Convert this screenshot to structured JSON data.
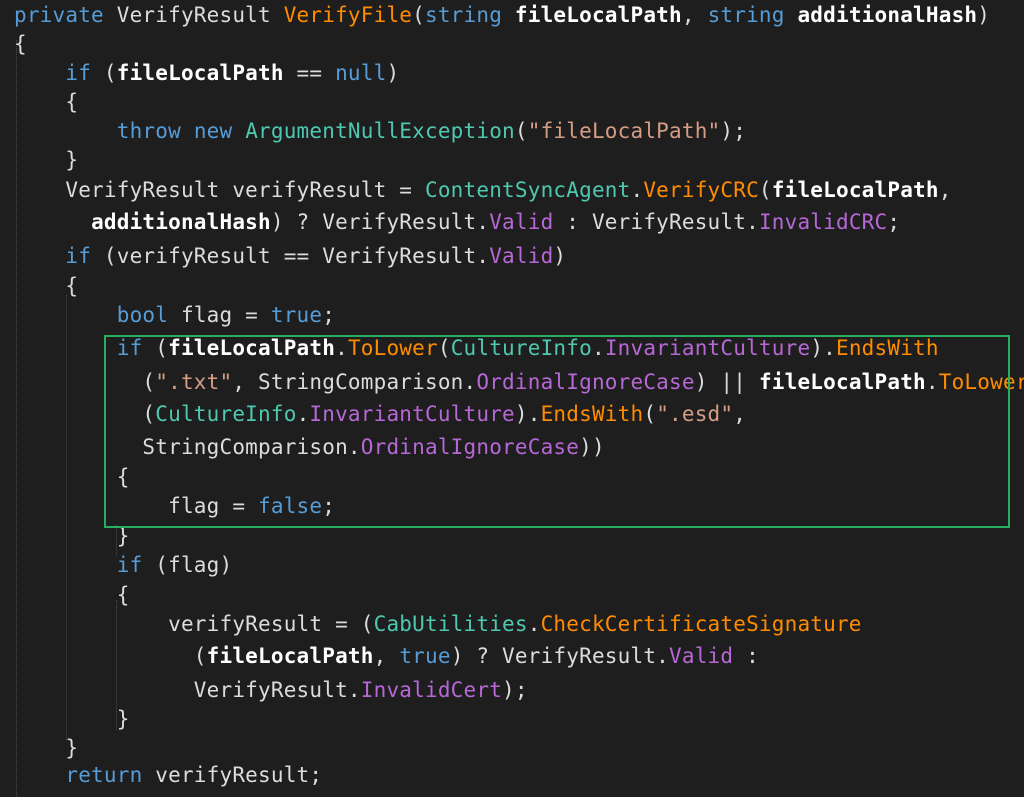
{
  "colors": {
    "background": "#1e1e1e",
    "keyword": "#569cd6",
    "class": "#4ec9b0",
    "method": "#ff8c00",
    "property": "#b767d6",
    "string": "#d69d85",
    "parameter": "#ffffff",
    "plain": "#dcdcdc",
    "highlight_border": "#27ae60"
  },
  "code": {
    "lines": [
      [
        [
          "kw",
          "private"
        ],
        [
          "plain",
          " "
        ],
        [
          "plain",
          "VerifyResult"
        ],
        [
          "plain",
          " "
        ],
        [
          "meth",
          "VerifyFile"
        ],
        [
          "punc",
          "("
        ],
        [
          "kw",
          "string"
        ],
        [
          "plain",
          " "
        ],
        [
          "param",
          "fileLocalPath"
        ],
        [
          "punc",
          ", "
        ],
        [
          "kw",
          "string"
        ],
        [
          "plain",
          " "
        ],
        [
          "param",
          "additionalHash"
        ],
        [
          "punc",
          ")"
        ]
      ],
      [
        [
          "punc",
          "{"
        ]
      ],
      [
        [
          "plain",
          "    "
        ],
        [
          "kw",
          "if"
        ],
        [
          "plain",
          " ("
        ],
        [
          "param",
          "fileLocalPath"
        ],
        [
          "plain",
          " == "
        ],
        [
          "kw",
          "null"
        ],
        [
          "punc",
          ")"
        ]
      ],
      [
        [
          "plain",
          "    "
        ],
        [
          "punc",
          "{"
        ]
      ],
      [
        [
          "plain",
          "        "
        ],
        [
          "kw",
          "throw"
        ],
        [
          "plain",
          " "
        ],
        [
          "kw",
          "new"
        ],
        [
          "plain",
          " "
        ],
        [
          "cls",
          "ArgumentNullException"
        ],
        [
          "punc",
          "("
        ],
        [
          "str",
          "\"fileLocalPath\""
        ],
        [
          "punc",
          ");"
        ]
      ],
      [
        [
          "plain",
          "    "
        ],
        [
          "punc",
          "}"
        ]
      ],
      [
        [
          "plain",
          "    "
        ],
        [
          "plain",
          "VerifyResult verifyResult = "
        ],
        [
          "cls",
          "ContentSyncAgent"
        ],
        [
          "punc",
          "."
        ],
        [
          "meth",
          "VerifyCRC"
        ],
        [
          "punc",
          "("
        ],
        [
          "param",
          "fileLocalPath"
        ],
        [
          "punc",
          ","
        ]
      ],
      [
        [
          "plain",
          "      "
        ],
        [
          "param",
          "additionalHash"
        ],
        [
          "plain",
          ") ? VerifyResult."
        ],
        [
          "prop",
          "Valid"
        ],
        [
          "plain",
          " : VerifyResult."
        ],
        [
          "prop",
          "InvalidCRC"
        ],
        [
          "punc",
          ";"
        ]
      ],
      [
        [
          "plain",
          "    "
        ],
        [
          "kw",
          "if"
        ],
        [
          "plain",
          " (verifyResult == VerifyResult."
        ],
        [
          "prop",
          "Valid"
        ],
        [
          "punc",
          ")"
        ]
      ],
      [
        [
          "plain",
          "    "
        ],
        [
          "punc",
          "{"
        ]
      ],
      [
        [
          "plain",
          "        "
        ],
        [
          "kw",
          "bool"
        ],
        [
          "plain",
          " flag = "
        ],
        [
          "kw",
          "true"
        ],
        [
          "punc",
          ";"
        ]
      ],
      [
        [
          "plain",
          "        "
        ],
        [
          "kw",
          "if"
        ],
        [
          "plain",
          " ("
        ],
        [
          "param",
          "fileLocalPath"
        ],
        [
          "punc",
          "."
        ],
        [
          "meth",
          "ToLower"
        ],
        [
          "punc",
          "("
        ],
        [
          "cls",
          "CultureInfo"
        ],
        [
          "punc",
          "."
        ],
        [
          "prop",
          "InvariantCulture"
        ],
        [
          "punc",
          ")."
        ],
        [
          "meth",
          "EndsWith"
        ]
      ],
      [
        [
          "plain",
          "          ("
        ],
        [
          "str",
          "\".txt\""
        ],
        [
          "plain",
          ", StringComparison."
        ],
        [
          "prop",
          "OrdinalIgnoreCase"
        ],
        [
          "plain",
          ") || "
        ],
        [
          "param",
          "fileLocalPath"
        ],
        [
          "punc",
          "."
        ],
        [
          "meth",
          "ToLower"
        ]
      ],
      [
        [
          "plain",
          "          ("
        ],
        [
          "cls",
          "CultureInfo"
        ],
        [
          "punc",
          "."
        ],
        [
          "prop",
          "InvariantCulture"
        ],
        [
          "punc",
          ")."
        ],
        [
          "meth",
          "EndsWith"
        ],
        [
          "punc",
          "("
        ],
        [
          "str",
          "\".esd\""
        ],
        [
          "punc",
          ","
        ]
      ],
      [
        [
          "plain",
          "          StringComparison."
        ],
        [
          "prop",
          "OrdinalIgnoreCase"
        ],
        [
          "punc",
          "))"
        ]
      ],
      [
        [
          "plain",
          "        "
        ],
        [
          "punc",
          "{"
        ]
      ],
      [
        [
          "plain",
          "            flag = "
        ],
        [
          "kw",
          "false"
        ],
        [
          "punc",
          ";"
        ]
      ],
      [
        [
          "plain",
          "        "
        ],
        [
          "punc",
          "}"
        ]
      ],
      [
        [
          "plain",
          "        "
        ],
        [
          "kw",
          "if"
        ],
        [
          "plain",
          " (flag)"
        ]
      ],
      [
        [
          "plain",
          "        "
        ],
        [
          "punc",
          "{"
        ]
      ],
      [
        [
          "plain",
          "            verifyResult = ("
        ],
        [
          "cls",
          "CabUtilities"
        ],
        [
          "punc",
          "."
        ],
        [
          "meth",
          "CheckCertificateSignature"
        ]
      ],
      [
        [
          "plain",
          "              ("
        ],
        [
          "param",
          "fileLocalPath"
        ],
        [
          "punc",
          ", "
        ],
        [
          "kw",
          "true"
        ],
        [
          "plain",
          ") ? VerifyResult."
        ],
        [
          "prop",
          "Valid"
        ],
        [
          "plain",
          " :"
        ]
      ],
      [
        [
          "plain",
          "              VerifyResult."
        ],
        [
          "prop",
          "InvalidCert"
        ],
        [
          "punc",
          ");"
        ]
      ],
      [
        [
          "plain",
          "        "
        ],
        [
          "punc",
          "}"
        ]
      ],
      [
        [
          "plain",
          "    "
        ],
        [
          "punc",
          "}"
        ]
      ],
      [
        [
          "plain",
          "    "
        ],
        [
          "kw",
          "return"
        ],
        [
          "plain",
          " verifyResult;"
        ]
      ]
    ]
  }
}
